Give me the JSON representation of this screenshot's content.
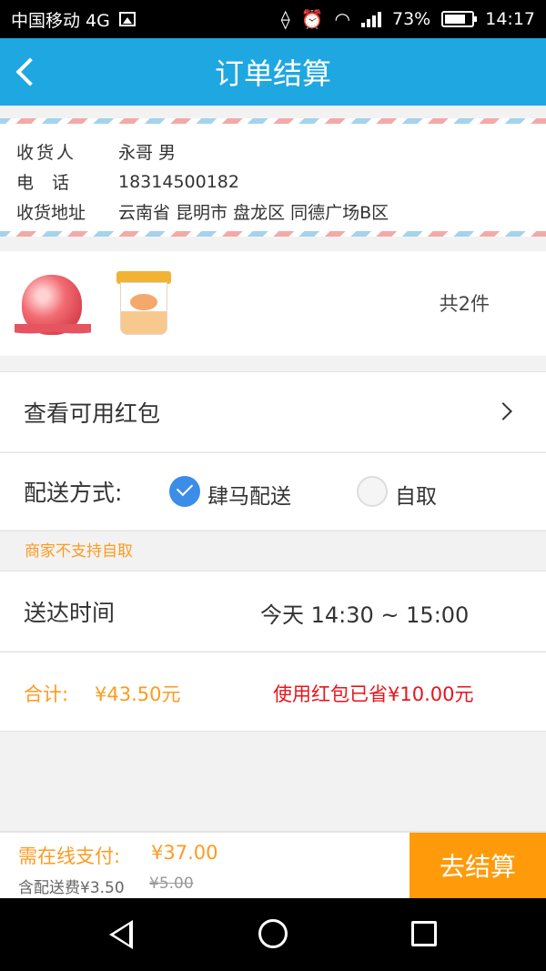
{
  "status_bar": {
    "carrier": "中国移动 4G",
    "network_badge": "4G",
    "battery": "73%",
    "time": "14:17"
  },
  "header": {
    "title": "订单结算"
  },
  "address": {
    "recipient_label": "收货人",
    "recipient_value": "永哥 男",
    "phone_label": "电话",
    "phone_value": "18314500182",
    "address_label": "收货地址",
    "address_value": "云南省 昆明市 盘龙区 同德广场B区"
  },
  "products": {
    "count_text": "共2件",
    "items": [
      {
        "name": "apple-product",
        "icon": "apple-image"
      },
      {
        "name": "cup-product",
        "icon": "cup-image"
      }
    ]
  },
  "coupon": {
    "label": "查看可用红包"
  },
  "delivery": {
    "label": "配送方式:",
    "options": [
      {
        "label": "肆马配送",
        "selected": true
      },
      {
        "label": "自取",
        "selected": false
      }
    ],
    "notice": "商家不支持自取"
  },
  "delivery_time": {
    "label": "送达时间",
    "value": "今天 14:30 ~ 15:00"
  },
  "totals": {
    "label": "合计:",
    "amount": "¥43.50元",
    "saved": "使用红包已省¥10.00元"
  },
  "checkout_bar": {
    "pay_label": "需在线支付:",
    "pay_amount": "¥37.00",
    "fee_label": "含配送费¥3.50",
    "fee_original": "¥5.00",
    "button_label": "去结算"
  },
  "colors": {
    "header_bg": "#1fa7e1",
    "accent_orange": "#ff9a1f",
    "saved_red": "#e8141b",
    "radio_blue": "#3b8de8"
  }
}
